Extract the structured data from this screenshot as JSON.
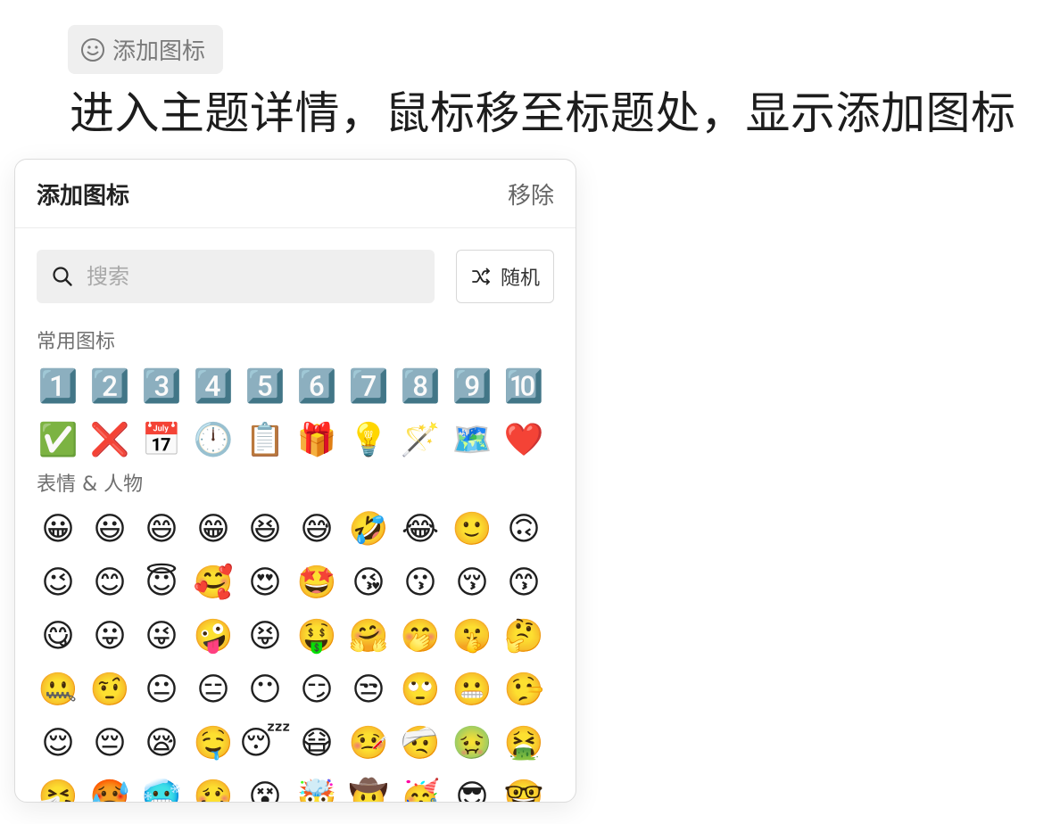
{
  "add_icon_chip": {
    "label": "添加图标",
    "icon": "smiley-outline-icon"
  },
  "page_title": "进入主题详情，鼠标移至标题处，显示添加图标",
  "panel": {
    "title": "添加图标",
    "remove_label": "移除",
    "search": {
      "placeholder": "搜索",
      "value": "",
      "icon": "search-icon"
    },
    "random": {
      "label": "随机",
      "icon": "shuffle-icon"
    },
    "sections": [
      {
        "label": "常用图标",
        "emojis": [
          "1️⃣",
          "2️⃣",
          "3️⃣",
          "4️⃣",
          "5️⃣",
          "6️⃣",
          "7️⃣",
          "8️⃣",
          "9️⃣",
          "🔟",
          "✅",
          "❌",
          "📅",
          "🕛",
          "📋",
          "🎁",
          "💡",
          "🪄",
          "🗺️",
          "❤️"
        ]
      },
      {
        "label": "表情 & 人物",
        "emojis": [
          "😀",
          "😃",
          "😄",
          "😁",
          "😆",
          "😅",
          "🤣",
          "😂",
          "🙂",
          "🙃",
          "😉",
          "😊",
          "😇",
          "🥰",
          "😍",
          "🤩",
          "😘",
          "😗",
          "😚",
          "😙",
          "😋",
          "😛",
          "😜",
          "🤪",
          "😝",
          "🤑",
          "🤗",
          "🤭",
          "🤫",
          "🤔",
          "🤐",
          "🤨",
          "😐",
          "😑",
          "😶",
          "😏",
          "😒",
          "🙄",
          "😬",
          "🤥",
          "😌",
          "😔",
          "😪",
          "🤤",
          "😴",
          "😷",
          "🤒",
          "🤕",
          "🤢",
          "🤮",
          "🤧",
          "🥵",
          "🥶",
          "🥴",
          "😵",
          "🤯",
          "🤠",
          "🥳",
          "😎",
          "🤓"
        ]
      }
    ]
  }
}
